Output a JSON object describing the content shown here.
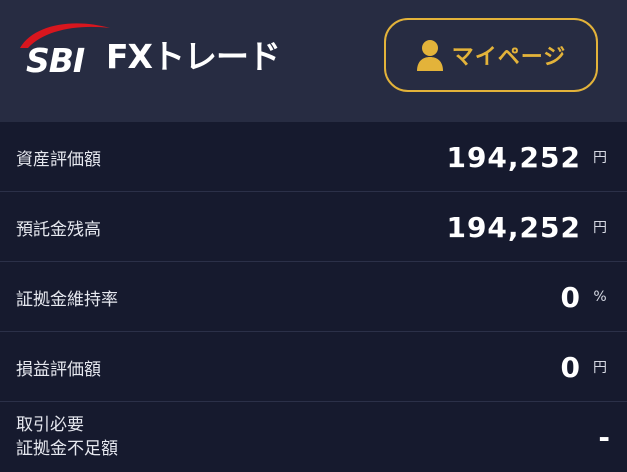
{
  "header": {
    "logo_brand": "SBI",
    "logo_product": "FXトレード",
    "mypage_label": "マイページ",
    "mypage_icon": "person-icon",
    "accent_color": "#e3b33a",
    "logo_swoosh_color": "#d8161e"
  },
  "rows": [
    {
      "label": "資産評価額",
      "value": "194,252",
      "unit": "円"
    },
    {
      "label": "預託金残高",
      "value": "194,252",
      "unit": "円"
    },
    {
      "label": "証拠金維持率",
      "value": "0",
      "unit": "%"
    },
    {
      "label": "損益評価額",
      "value": "0",
      "unit": "円"
    },
    {
      "label_line1": "取引必要",
      "label_line2": "証拠金不足額",
      "value": "-",
      "unit": ""
    }
  ]
}
